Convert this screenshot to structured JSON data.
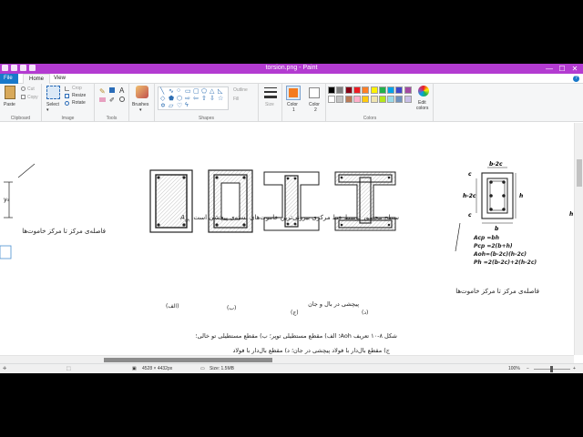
{
  "window": {
    "title": "torsion.png - Paint",
    "minimize": "—",
    "maximize": "☐",
    "close": "✕"
  },
  "tabs": {
    "file": "File",
    "home": "Home",
    "view": "View"
  },
  "ribbon": {
    "clipboard": {
      "label": "Clipboard",
      "paste": "Paste",
      "cut": "Cut",
      "copy": "Copy"
    },
    "image": {
      "label": "Image",
      "select": "Select",
      "crop": "Crop",
      "resize": "Resize",
      "rotate": "Rotate"
    },
    "tools": {
      "label": "Tools"
    },
    "brushes": {
      "label": "Brushes"
    },
    "shapes": {
      "label": "Shapes",
      "outline": "Outline",
      "fill": "Fill"
    },
    "size": {
      "label": "Size"
    },
    "color1": {
      "label": "Color",
      "sub": "1",
      "value": "#f47b20"
    },
    "color2": {
      "label": "Color",
      "sub": "2",
      "value": "#ffffff"
    },
    "colors": {
      "label": "Colors",
      "row1": [
        "#000000",
        "#7f7f7f",
        "#880015",
        "#ed1c24",
        "#ff7f27",
        "#fff200",
        "#22b14c",
        "#00a2e8",
        "#3f48cc",
        "#a349a4"
      ],
      "row2": [
        "#ffffff",
        "#c3c3c3",
        "#b97a57",
        "#ffaec9",
        "#ffc90e",
        "#efe4b0",
        "#b5e61d",
        "#99d9ea",
        "#7092be",
        "#c8bfe7"
      ]
    },
    "edit_colors": {
      "line1": "Edit",
      "line2": "colors"
    }
  },
  "status": {
    "dimensions": "4528 × 4432px",
    "size": "Size: 1.5MB",
    "zoom": "100%"
  },
  "image": {
    "top_caption": "سطح محصور توسط خط مرکزی بیرونی‌ترین خاموت‌های بسته‌ی پیچشی است.",
    "top_caption_symbol": "A",
    "top_caption_sub": "oh",
    "left_note": "فاصله‌ی مرکز تا مرکز خاموت‌ها",
    "left_y0": "y₀",
    "fig_labels": [
      "(الف)",
      "(ب)",
      "(ج)",
      "(د)"
    ],
    "caption_line1": "شکل ۸-۱۰ تعریف Aoh؛ الف) مقطع مستطیلی توپر؛ ب) مقطع مستطیلی تو خالی؛",
    "caption_line2": "ج) مقطع بال‌دار با فولاد پیچشی در جان؛ د) مقطع بال‌دار با فولاد",
    "caption_line3": "پیچشی در بال و جان",
    "section_dims": {
      "top": "b-2c",
      "c": "c",
      "h2c": "h-2c",
      "h": "h",
      "b": "b"
    },
    "formulas": [
      "Acp =bh",
      "Pcp =2(b+h)",
      "Aoh=(b-2c)(h-2c)",
      "Ph =2(b-2c)+2(h-2c)"
    ],
    "right_note": "فاصله‌ی مرکز تا مرکز خاموت‌ها",
    "edge_h": "h"
  }
}
